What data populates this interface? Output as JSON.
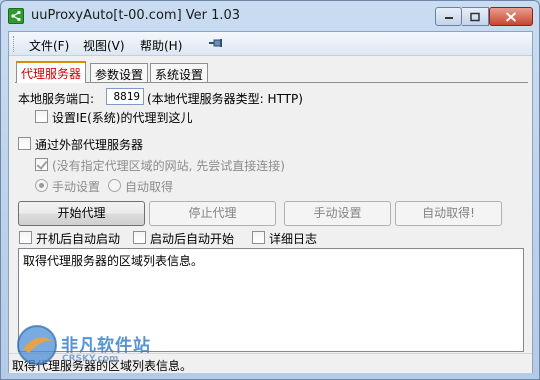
{
  "window": {
    "title": "uuProxyAuto[t-00.com] Ver 1.03",
    "accent_close": "#c7452f"
  },
  "menu": {
    "items": [
      "文件(F)",
      "视图(V)",
      "帮助(H)"
    ]
  },
  "tabs": [
    "代理服务器",
    "参数设置",
    "系统设置"
  ],
  "local": {
    "port_label": "本地服务端口:",
    "port_value": "8819",
    "type_label": "(本地代理服务器类型: HTTP)",
    "set_ie_label": "设置IE(系统)的代理到这儿"
  },
  "external": {
    "label": "通过外部代理服务器",
    "direct_first_label": "(没有指定代理区域的网站, 先尝试直接连接)",
    "manual_label": "手动设置",
    "auto_label": "自动取得"
  },
  "buttons": {
    "start": "开始代理",
    "stop": "停止代理",
    "manual": "手动设置",
    "auto": "自动取得!"
  },
  "options": {
    "autostart_boot": "开机后自动启动",
    "autostart_proxy": "启动后自动开始",
    "verbose_log": "详细日志"
  },
  "log_text": "取得代理服务器的区域列表信息。",
  "status_text": "取得代理服务器的区域列表信息。",
  "watermark": {
    "brand": "非凡软件站",
    "sub": "CRSKY.com"
  }
}
